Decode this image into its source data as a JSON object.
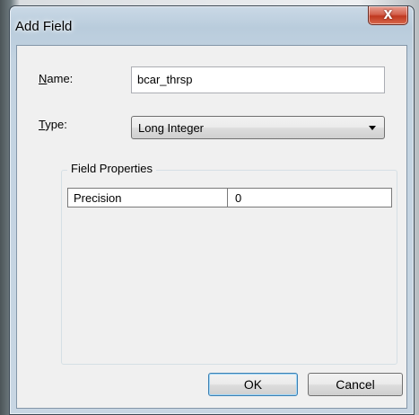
{
  "window": {
    "title": "Add Field",
    "close_label": "X"
  },
  "form": {
    "name_label": "Name:",
    "name_label_hotkey": "N",
    "name_label_rest": "ame:",
    "name_value": "bcar_thrsp",
    "type_label": "Type:",
    "type_label_hotkey": "T",
    "type_label_rest": "ype:",
    "type_value": "Long Integer"
  },
  "field_properties": {
    "title": "Field Properties",
    "rows": [
      {
        "property": "Precision",
        "value": "0"
      }
    ]
  },
  "buttons": {
    "ok": "OK",
    "cancel": "Cancel"
  },
  "colors": {
    "close_button": "#c0381f",
    "ok_border": "#3c7fb1"
  }
}
